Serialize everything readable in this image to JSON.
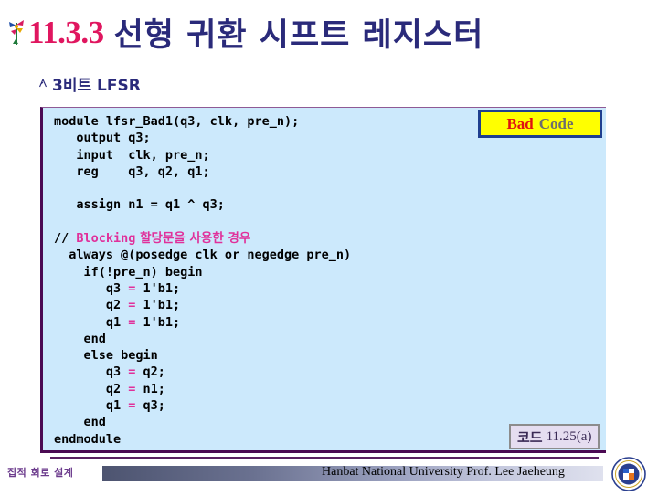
{
  "slide": {
    "title_number": "11.3.3",
    "title_text": "선형 귀환 시프트 레지스터",
    "title_number_color": "#e0165f",
    "title_text_color": "#2a2a7a",
    "bullet_icon": "decorative-star-bullet-icon"
  },
  "subtitle": {
    "bullet": "⸺",
    "bullet_icon": "person-marker-bullet-icon",
    "text": "3비트 LFSR"
  },
  "badge": {
    "bad_label": "Bad",
    "code_label": "Code",
    "background_color": "#ffff00",
    "border_color": "#1f3f8f",
    "bad_color": "#e01010",
    "code_color": "#6d6d6d"
  },
  "code": {
    "background_color": "#cce9fc",
    "border_color": "#4b0a53",
    "operator_color": "#e0309a",
    "lines": [
      "module lfsr_Bad1(q3, clk, pre_n);",
      "   output q3;",
      "   input  clk, pre_n;",
      "   reg    q3, q2, q1;",
      "",
      "   assign n1 = q1 ^ q3;",
      "",
      "// Blocking 할당문을 사용한 경우",
      "  always @(posedge clk or negedge pre_n)",
      "    if(!pre_n) begin",
      "       q3 = 1'b1;",
      "       q2 = 1'b1;",
      "       q1 = 1'b1;",
      "    end",
      "    else begin",
      "       q3 = q2;",
      "       q2 = n1;",
      "       q1 = q3;",
      "    end",
      "endmodule"
    ],
    "comment_slash": "//",
    "comment_en": "Blocking",
    "comment_ko": "할당문을 사용한 경우"
  },
  "caption": {
    "label_ko": "코드",
    "number": "11.25(a)",
    "background_color": "#e5ddf0",
    "border_color": "#8c8c8c"
  },
  "footer": {
    "left_text": "집적 회로 설계",
    "credit": "Hanbat National University Prof. Lee Jaeheung",
    "logo_icon": "university-seal-logo"
  }
}
